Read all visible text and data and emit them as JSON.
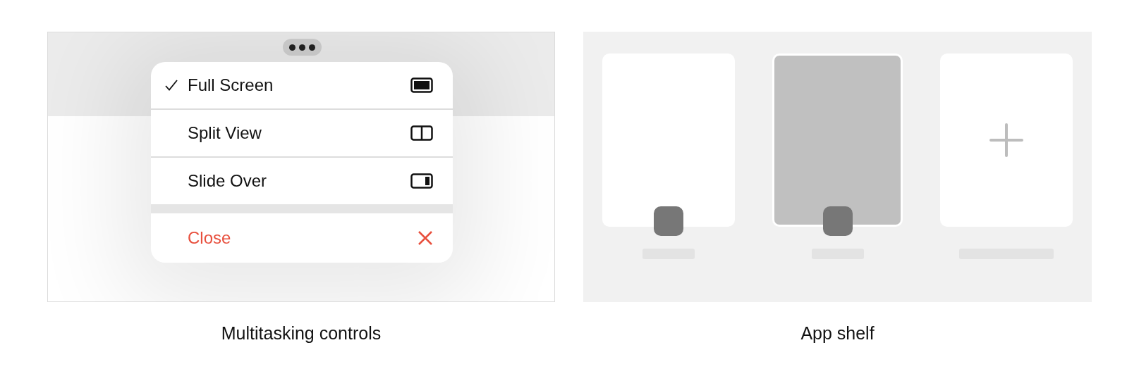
{
  "multitasking": {
    "caption": "Multitasking controls",
    "menu": [
      {
        "label": "Full Screen",
        "kind": "full-screen",
        "selected": true
      },
      {
        "label": "Split View",
        "kind": "split-view",
        "selected": false
      },
      {
        "label": "Slide Over",
        "kind": "slide-over",
        "selected": false
      },
      {
        "label": "Close",
        "kind": "close",
        "selected": false
      }
    ]
  },
  "app_shelf": {
    "caption": "App shelf",
    "cards": [
      {
        "kind": "app",
        "selected": false
      },
      {
        "kind": "app",
        "selected": true
      },
      {
        "kind": "add",
        "selected": false
      }
    ]
  }
}
